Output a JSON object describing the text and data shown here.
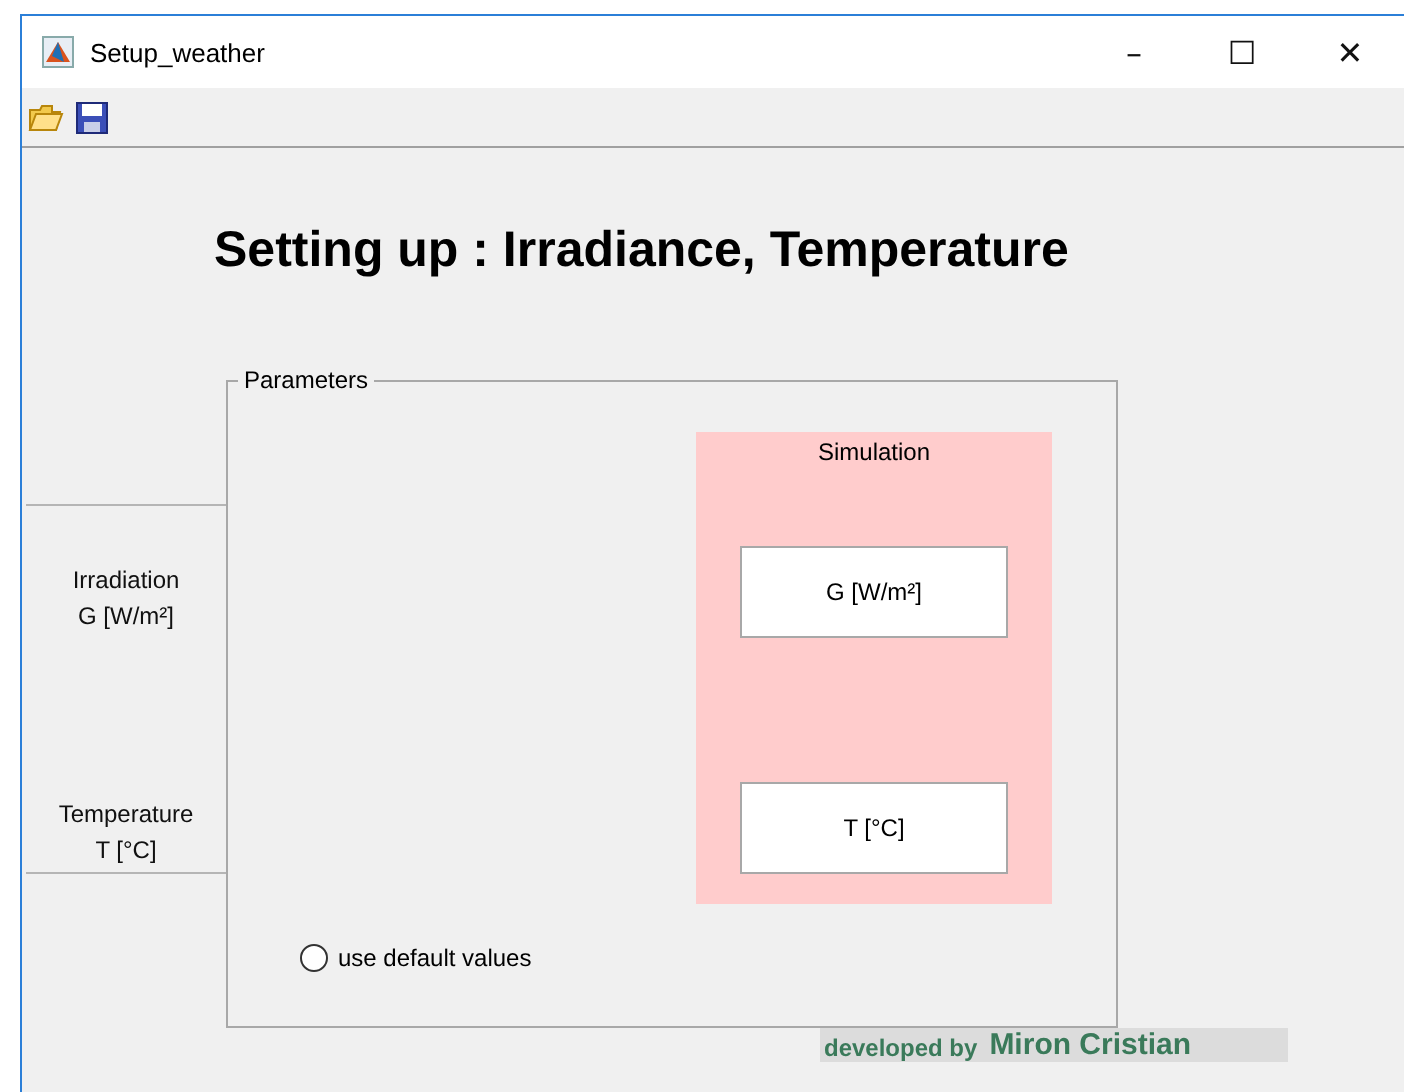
{
  "window": {
    "title": "Setup_weather",
    "controls": [
      "–",
      "☐",
      "✕"
    ]
  },
  "heading": "Setting up : Irradiance, Temperature",
  "side_labels": [
    {
      "lines": [
        "Irradiation",
        "G [W/m²]"
      ]
    },
    {
      "lines": [
        "Temperature",
        "T [°C]"
      ]
    }
  ],
  "parameters": {
    "title": "Parameters",
    "simulation": {
      "title": "Simulation",
      "fields": [
        {
          "value": "G [W/m²]"
        },
        {
          "value": "T [°C]"
        }
      ]
    },
    "default_option": {
      "label": "use default values",
      "selected": false
    }
  },
  "footer": {
    "prefix": "developed by",
    "author": "Miron Cristian"
  }
}
